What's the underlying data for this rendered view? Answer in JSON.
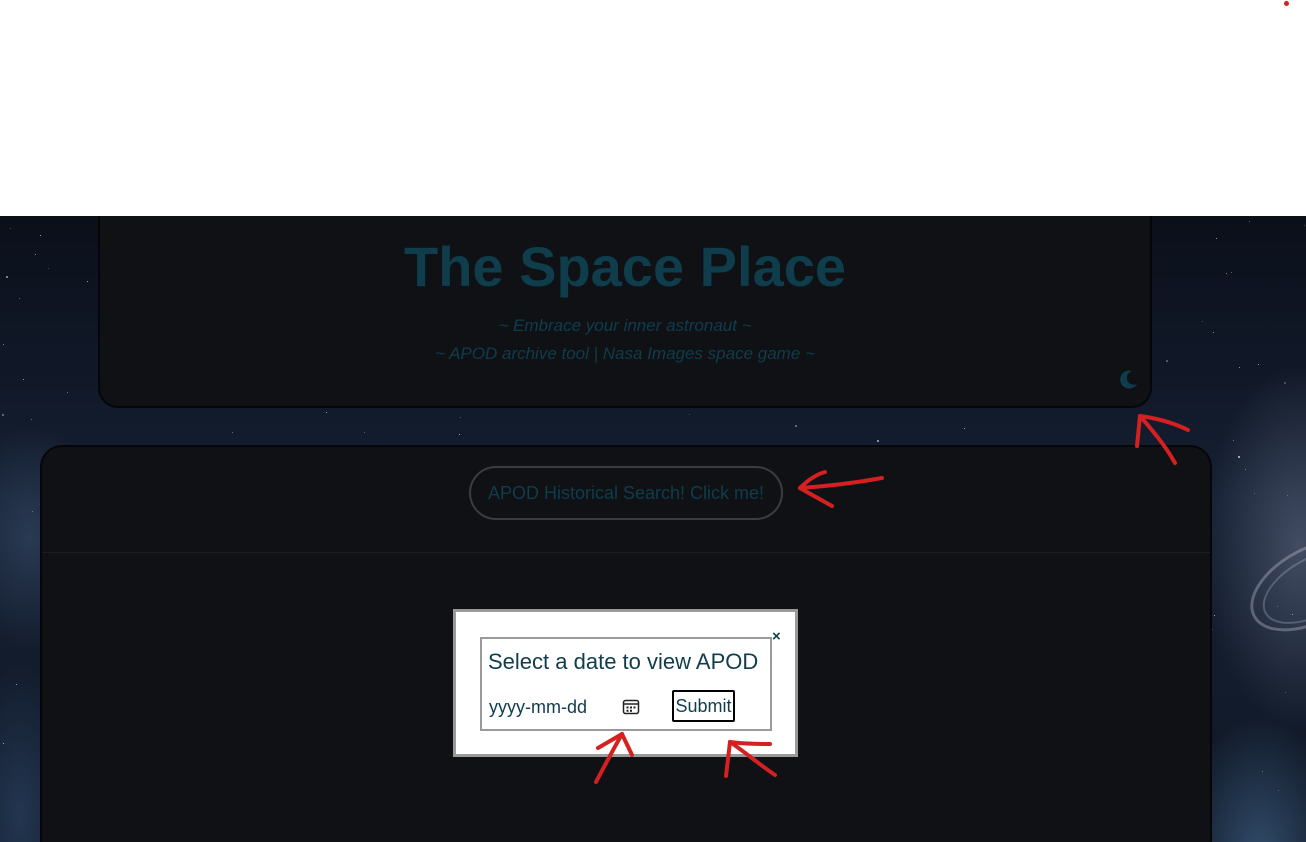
{
  "header": {
    "title": "The Space Place",
    "tagline_1": "~ Embrace your inner astronaut ~",
    "tagline_2": "~ APOD archive tool | Nasa Images space game ~",
    "theme_toggle_icon": "moon-icon"
  },
  "main": {
    "apod_button_label": "APOD Historical Search! Click me!"
  },
  "modal": {
    "close_label": "×",
    "title": "Select a date to view APOD",
    "date_placeholder": "yyyy-mm-dd",
    "calendar_icon": "calendar-icon",
    "submit_label": "Submit"
  },
  "colors": {
    "text_teal": "#0f3d4c",
    "card_bg": "#0f1115",
    "annotation_red": "#d42020"
  }
}
